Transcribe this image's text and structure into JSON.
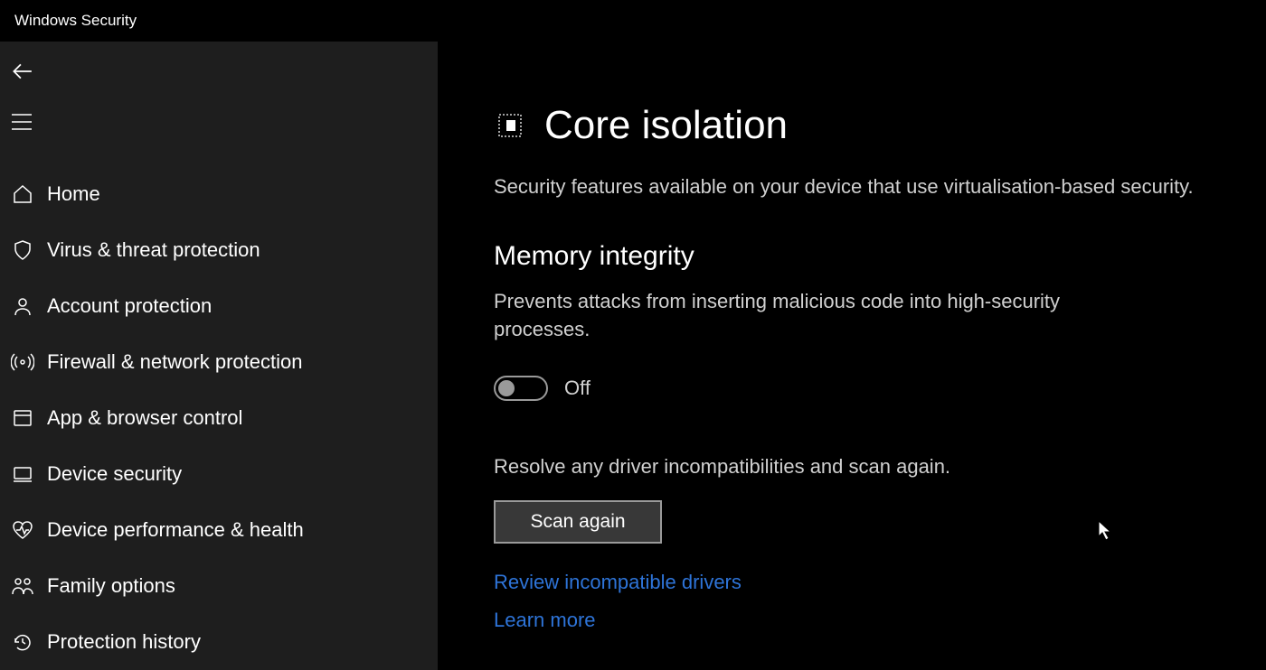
{
  "window": {
    "title": "Windows Security"
  },
  "sidebar": {
    "items": [
      {
        "label": "Home"
      },
      {
        "label": "Virus & threat protection"
      },
      {
        "label": "Account protection"
      },
      {
        "label": "Firewall & network protection"
      },
      {
        "label": "App & browser control"
      },
      {
        "label": "Device security"
      },
      {
        "label": "Device performance & health"
      },
      {
        "label": "Family options"
      },
      {
        "label": "Protection history"
      }
    ]
  },
  "main": {
    "title": "Core isolation",
    "subtitle": "Security features available on your device that use virtualisation-based security.",
    "section_title": "Memory integrity",
    "section_desc": "Prevents attacks from inserting malicious code into high-security processes.",
    "toggle_state": "Off",
    "resolve_text": "Resolve any driver incompatibilities and scan again.",
    "scan_button": "Scan again",
    "review_link": "Review incompatible drivers",
    "learn_link": "Learn more"
  }
}
